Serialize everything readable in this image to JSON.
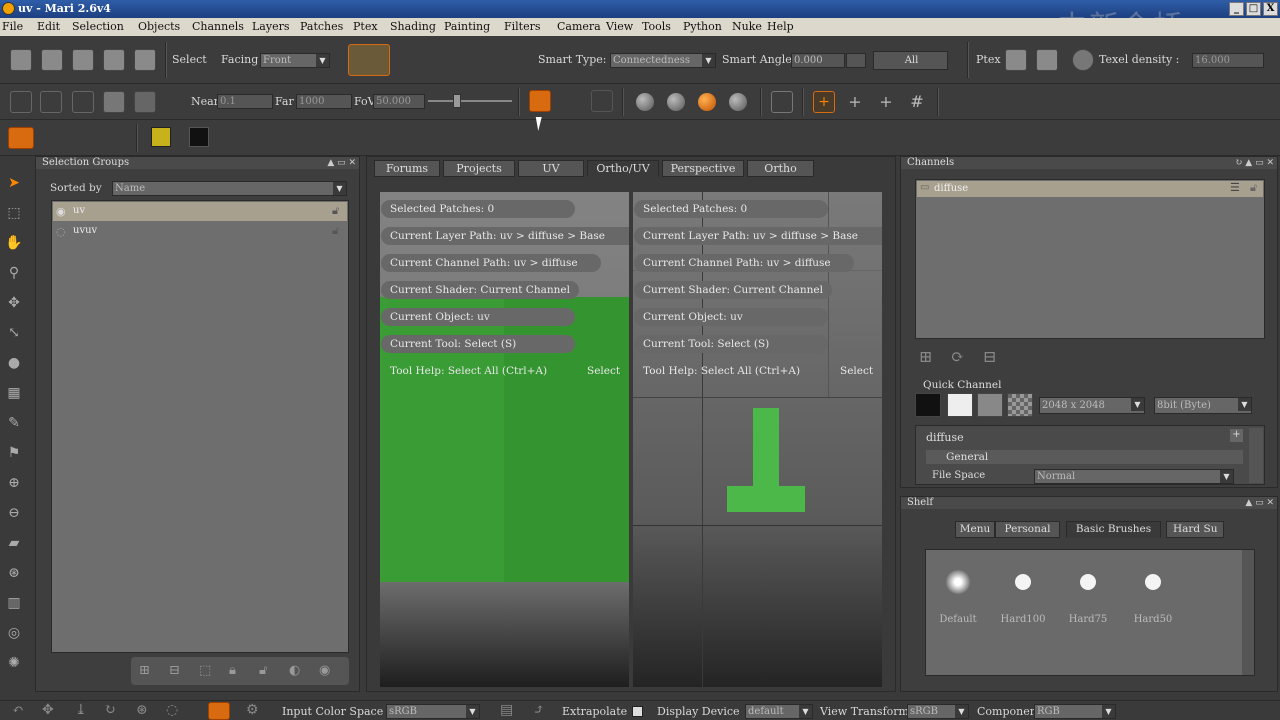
{
  "window": {
    "title": "uv - Mari 2.6v4",
    "watermark": "中新金桥",
    "buttons": [
      "_",
      "□",
      "X"
    ]
  },
  "menubar": [
    "File",
    "Edit",
    "Selection",
    "Objects",
    "Channels",
    "Layers",
    "Patches",
    "Ptex",
    "Shading",
    "Painting",
    "Filters",
    "Camera",
    "View",
    "Tools",
    "Python",
    "Nuke",
    "Help"
  ],
  "toolbar1": {
    "select_label": "Select",
    "facing_label": "Facing",
    "facing_value": "Front",
    "smart_type_label": "Smart Type:",
    "smart_type_value": "Connectedness",
    "smart_angle_label": "Smart Angle",
    "smart_angle_value": "0.000",
    "all_button": "All",
    "ptex_label": "Ptex",
    "texel_density_label": "Texel density :",
    "texel_density_value": "16.000"
  },
  "toolbar2": {
    "near_label": "Near",
    "near_value": "0.1",
    "far_label": "Far",
    "far_value": "1000",
    "fov_label": "FoV",
    "fov_value": "50.000"
  },
  "toolbar3": {
    "foreground_color": "#c8b21c",
    "background_color": "#111111"
  },
  "selection_groups": {
    "title": "Selection Groups",
    "sorted_by_label": "Sorted by",
    "sorted_by_value": "Name",
    "items": [
      "uv",
      "uvuv"
    ]
  },
  "viewport_tabs": [
    "Forums",
    "Projects",
    "UV",
    "Ortho/UV",
    "Perspective",
    "Ortho"
  ],
  "active_tab": "Ortho/UV",
  "hud": {
    "selected_patches": "Selected Patches: 0",
    "layer_path": "Current Layer Path: uv > diffuse > Base",
    "channel_path": "Current Channel Path: uv > diffuse",
    "shader": "Current Shader: Current Channel",
    "object": "Current Object: uv",
    "tool": "Current Tool: Select (S)",
    "tool_help": "Tool Help: Select All (Ctrl+A)",
    "tool_help_suffix": "Select"
  },
  "channels": {
    "title": "Channels",
    "items": [
      "diffuse"
    ],
    "quick_channel_label": "Quick Channel",
    "size_value": "2048 x 2048",
    "depth_value": "8bit (Byte)",
    "props_title": "diffuse",
    "group_general": "General",
    "file_space_label": "File Space",
    "file_space_value": "Normal"
  },
  "shelf": {
    "title": "Shelf",
    "tabs": [
      "Menu",
      "Personal",
      "Basic Brushes",
      "Hard Su"
    ],
    "active_tab": "Basic Brushes",
    "brushes": [
      "Default",
      "Hard100",
      "Hard75",
      "Hard50"
    ]
  },
  "bottombar": {
    "input_color_space_label": "Input Color Space",
    "input_color_space_value": "sRGB",
    "extrapolate_label": "Extrapolate",
    "display_device_label": "Display Device",
    "display_device_value": "default",
    "view_transform_label": "View Transform",
    "view_transform_value": "sRGB",
    "component_label": "Component",
    "component_value": "RGB"
  }
}
